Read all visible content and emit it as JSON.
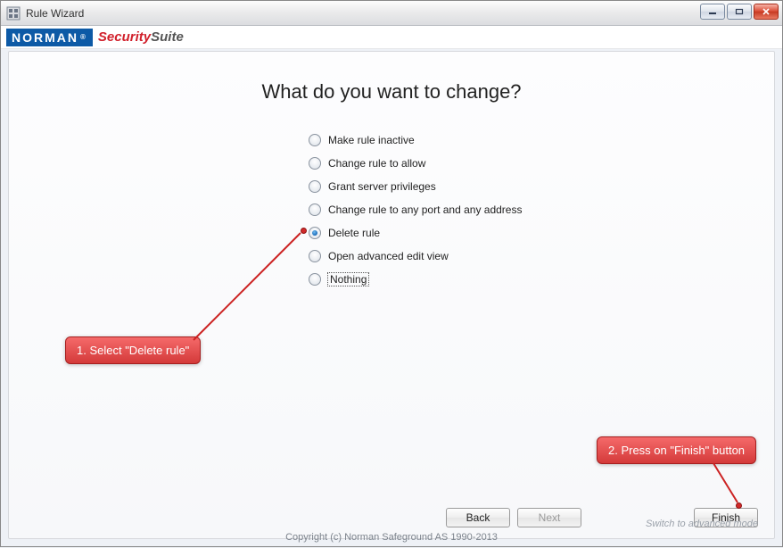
{
  "window": {
    "title": "Rule Wizard"
  },
  "brand": {
    "block": "NORMAN",
    "reg": "®",
    "part1": "Security",
    "part2": "Suite"
  },
  "heading": "What do you want to change?",
  "options": [
    {
      "label": "Make rule inactive",
      "selected": false,
      "dotted": false
    },
    {
      "label": "Change rule to allow",
      "selected": false,
      "dotted": false
    },
    {
      "label": "Grant server privileges",
      "selected": false,
      "dotted": false
    },
    {
      "label": "Change rule to any port and any address",
      "selected": false,
      "dotted": false
    },
    {
      "label": "Delete rule",
      "selected": true,
      "dotted": false
    },
    {
      "label": "Open advanced edit view",
      "selected": false,
      "dotted": false
    },
    {
      "label": "Nothing",
      "selected": false,
      "dotted": true
    }
  ],
  "buttons": {
    "back": "Back",
    "next": "Next",
    "finish": "Finish"
  },
  "switch_link": "Switch to advanced mode",
  "copyright": "Copyright (c) Norman Safeground AS 1990-2013",
  "annotations": {
    "callout1": "1. Select \"Delete rule\"",
    "callout2": "2. Press on \"Finish\" button"
  }
}
